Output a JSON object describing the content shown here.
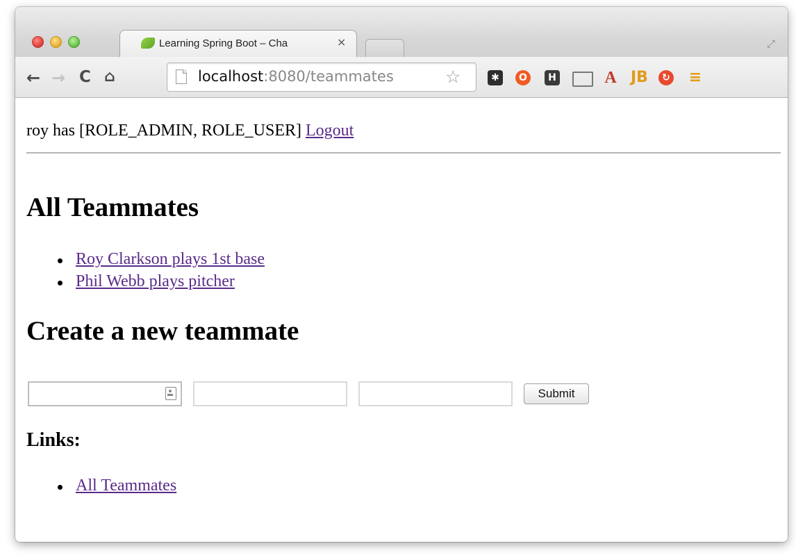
{
  "browser": {
    "tab_title": "Learning Spring Boot – Cha",
    "tab_close": "×",
    "url_host": "localhost",
    "url_path": ":8080/teammates"
  },
  "auth": {
    "user": "roy",
    "text": " has [ROLE_ADMIN, ROLE_USER] ",
    "logout_label": "Logout"
  },
  "teammates": {
    "heading": "All Teammates",
    "items": [
      "Roy Clarkson plays 1st base",
      "Phil Webb plays pitcher"
    ]
  },
  "create_form": {
    "heading": "Create a new teammate",
    "fields": [
      "",
      "",
      ""
    ],
    "submit_label": "Submit"
  },
  "links": {
    "heading": "Links:",
    "items": [
      "All Teammates"
    ]
  },
  "extensions": {
    "icons": [
      "slack-icon",
      "opera-icon",
      "h-icon",
      "cast-icon",
      "acrobat-icon",
      "jetbrains-icon",
      "sync-icon",
      "menu-icon"
    ]
  }
}
